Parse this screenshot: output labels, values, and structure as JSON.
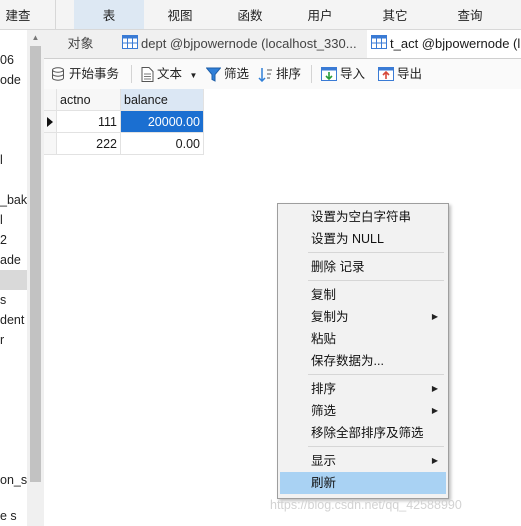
{
  "ribbon": {
    "items": [
      {
        "label": "建查询"
      },
      {
        "label": "表"
      },
      {
        "label": "视图"
      },
      {
        "label": "函数"
      },
      {
        "label": "用户"
      },
      {
        "label": "其它"
      },
      {
        "label": "查询"
      }
    ]
  },
  "nav": {
    "items": [
      {
        "label": "06"
      },
      {
        "label": "ode"
      },
      {
        "label": "l"
      },
      {
        "label": "_bak"
      },
      {
        "label": "l"
      },
      {
        "label": "2"
      },
      {
        "label": "ade"
      },
      {
        "label": "s"
      },
      {
        "label": "dent"
      },
      {
        "label": "r"
      },
      {
        "label": "on_sc"
      },
      {
        "label": "e s"
      }
    ]
  },
  "tabs": [
    {
      "label": "对象"
    },
    {
      "label": "dept @bjpowernode (localhost_330..."
    },
    {
      "label": "t_act @bjpowernode (l"
    }
  ],
  "toolbar": {
    "begin_tx": "开始事务",
    "text": "文本",
    "filter": "筛选",
    "sort": "排序",
    "import": "导入",
    "export": "导出"
  },
  "grid": {
    "columns": [
      "actno",
      "balance"
    ],
    "rows": [
      {
        "actno": "111",
        "balance": "20000.00"
      },
      {
        "actno": "222",
        "balance": "0.00"
      }
    ]
  },
  "context_menu": {
    "set_empty": "设置为空白字符串",
    "set_null": "设置为 NULL",
    "delete_record": "删除 记录",
    "copy": "复制",
    "copy_as": "复制为",
    "paste": "粘贴",
    "save_data_as": "保存数据为...",
    "sort": "排序",
    "filter": "筛选",
    "remove_sort_filter": "移除全部排序及筛选",
    "display": "显示",
    "refresh": "刷新"
  },
  "watermark": "https://blog.csdn.net/qq_42588990",
  "colors": {
    "selection": "#1b6fd1",
    "menu_highlight": "#a9d2f3",
    "active_ribbon": "#dde8f3"
  }
}
